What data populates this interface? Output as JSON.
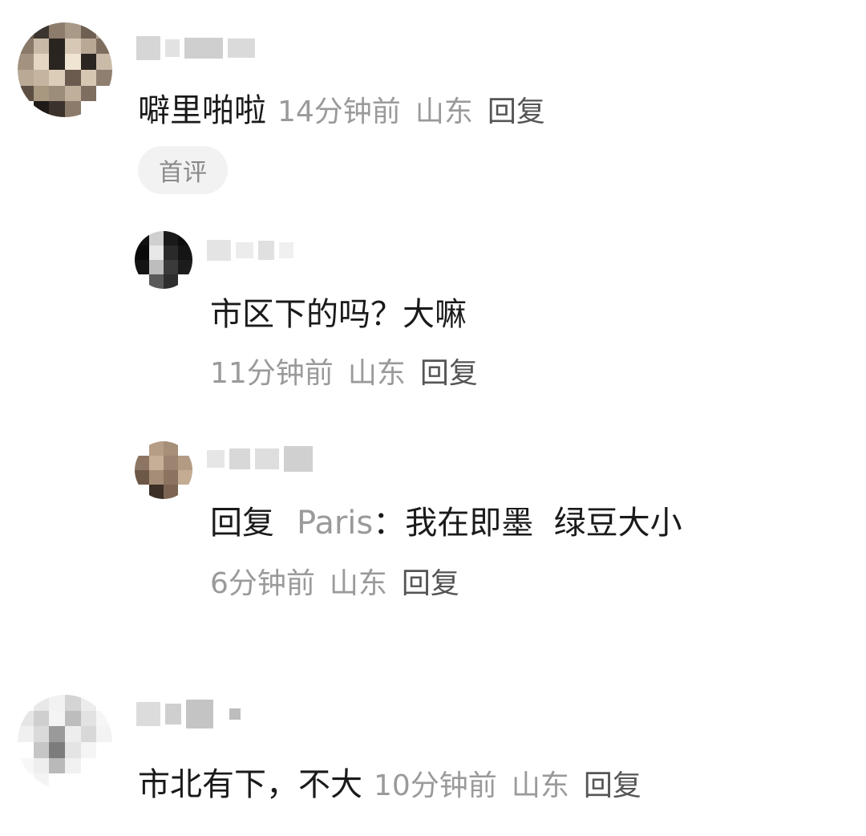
{
  "comments": [
    {
      "text": "噼里啪啦",
      "time": "14分钟前",
      "location": "山东",
      "reply_label": "回复",
      "badge": "首评",
      "replies": [
        {
          "text": "市区下的吗？大嘛",
          "time": "11分钟前",
          "location": "山东",
          "reply_label": "回复"
        },
        {
          "reply_prefix": "回复",
          "mention": "Paris",
          "colon": "：",
          "text": "我在即墨  绿豆大小",
          "time": "6分钟前",
          "location": "山东",
          "reply_label": "回复"
        }
      ]
    },
    {
      "text": "市北有下，不大",
      "time": "10分钟前",
      "location": "山东",
      "reply_label": "回复"
    }
  ],
  "colors": {
    "primary_text": "#1a1a1a",
    "meta_text": "#9a9a9a",
    "badge_bg": "#f2f2f2"
  },
  "icons": [
    "avatar-pixelated",
    "username-blurred"
  ]
}
